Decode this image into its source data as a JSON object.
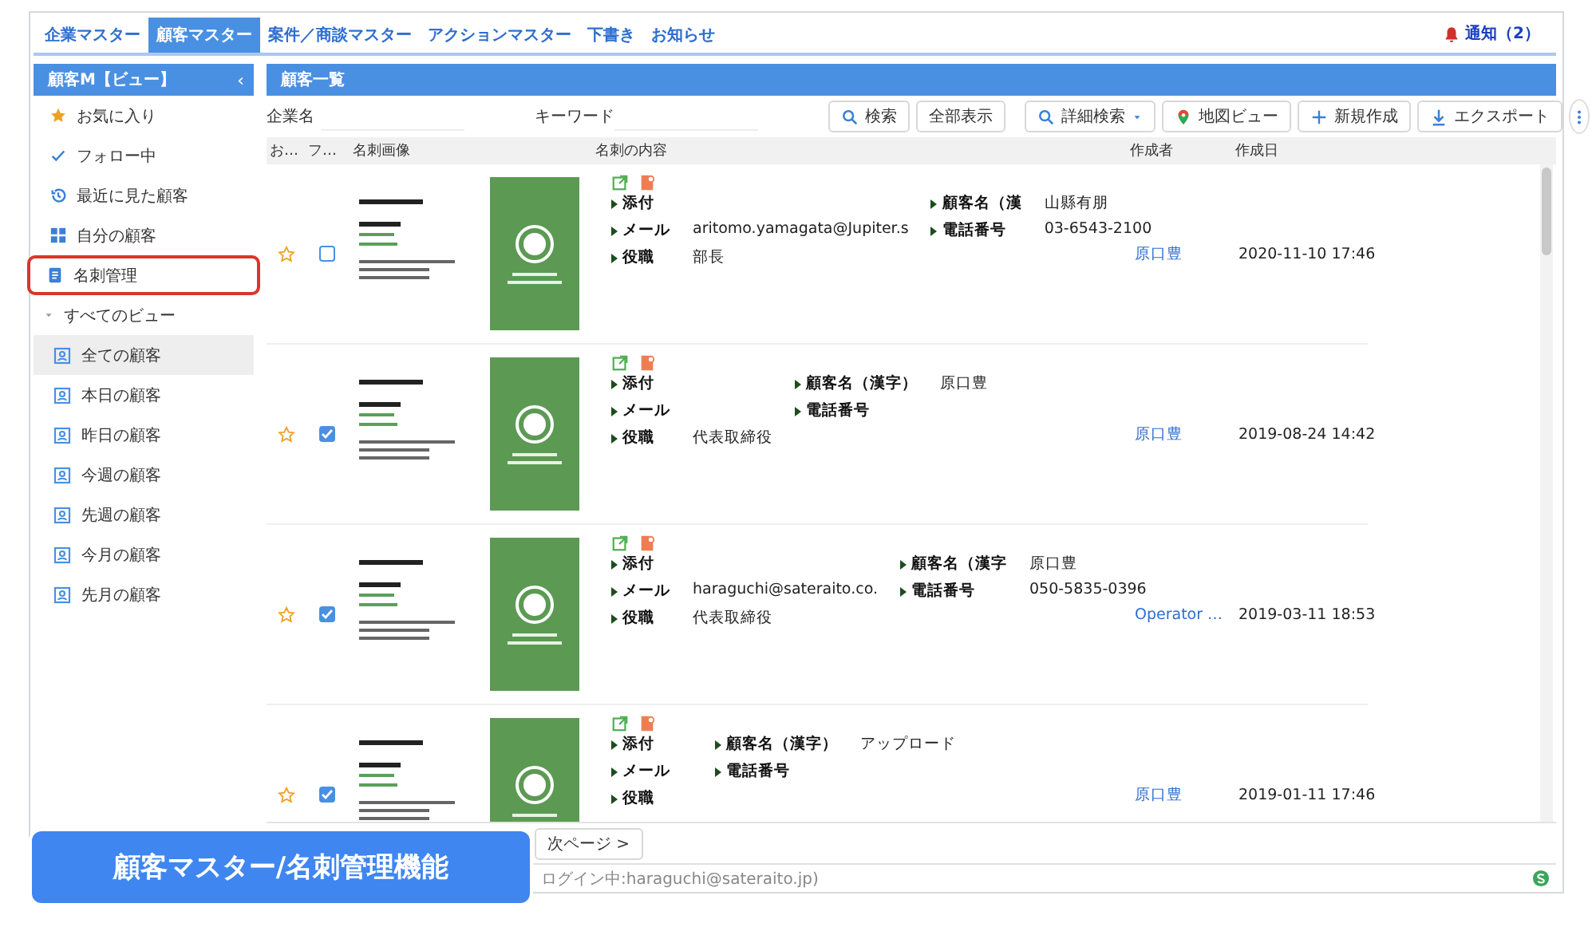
{
  "nav": {
    "tabs": [
      {
        "label": "企業マスター",
        "selected": false
      },
      {
        "label": "顧客マスター",
        "selected": true
      },
      {
        "label": "案件／商談マスター",
        "selected": false
      },
      {
        "label": "アクションマスター",
        "selected": false
      },
      {
        "label": "下書き",
        "selected": false
      },
      {
        "label": "お知らせ",
        "selected": false
      }
    ],
    "notification": "通知（2）"
  },
  "sidebar": {
    "title": "顧客M【ビュー】",
    "collapse": "‹",
    "items": [
      {
        "kind": "favorite",
        "label": "お気に入り",
        "highlighted": false
      },
      {
        "kind": "follow",
        "label": "フォロー中",
        "highlighted": false
      },
      {
        "kind": "recent",
        "label": "最近に見た顧客",
        "highlighted": false
      },
      {
        "kind": "mine",
        "label": "自分の顧客",
        "highlighted": false
      },
      {
        "kind": "cards",
        "label": "名刺管理",
        "highlighted": true
      }
    ],
    "section": {
      "label": "すべてのビュー",
      "expanded": true,
      "children": [
        {
          "label": "全ての顧客",
          "selected": true
        },
        {
          "label": "本日の顧客",
          "selected": false
        },
        {
          "label": "昨日の顧客",
          "selected": false
        },
        {
          "label": "今週の顧客",
          "selected": false
        },
        {
          "label": "先週の顧客",
          "selected": false
        },
        {
          "label": "今月の顧客",
          "selected": false
        },
        {
          "label": "先月の顧客",
          "selected": false
        }
      ]
    }
  },
  "panel": {
    "title": "顧客一覧",
    "filters": [
      {
        "label": "企業名"
      },
      {
        "label": "キーワード"
      }
    ],
    "buttons": [
      {
        "kind": "search",
        "label": "検索"
      },
      {
        "kind": "plain",
        "label": "全部表示"
      },
      {
        "kind": "advanced",
        "label": "詳細検索"
      },
      {
        "kind": "map",
        "label": "地図ビュー"
      },
      {
        "kind": "new",
        "label": "新規作成"
      },
      {
        "kind": "export",
        "label": "エクスポート"
      }
    ],
    "columns": [
      "お…",
      "フ…",
      "名刺画像",
      "名刺の内容",
      "作成者",
      "作成日"
    ],
    "rows": [
      {
        "checked": false,
        "left": [
          {
            "label": "添付"
          },
          {
            "label": "メール",
            "value": "aritomo.yamagata@Jupiter.s"
          },
          {
            "label": "役職",
            "value": "部長"
          }
        ],
        "right": [
          {
            "label": "顧客名（漢",
            "value": "山縣有朋"
          },
          {
            "label": "電話番号",
            "value": "03-6543-2100"
          }
        ],
        "creator": "原口豊",
        "date": "2020-11-10 17:46"
      },
      {
        "checked": true,
        "left": [
          {
            "label": "添付"
          },
          {
            "label": "メール"
          },
          {
            "label": "役職",
            "value": "代表取締役"
          }
        ],
        "right": [
          {
            "label": "顧客名（漢字）",
            "value": "原口豊"
          },
          {
            "label": "電話番号"
          }
        ],
        "creator": "原口豊",
        "date": "2019-08-24 14:42"
      },
      {
        "checked": true,
        "left": [
          {
            "label": "添付"
          },
          {
            "label": "メール",
            "value": "haraguchi@sateraito.co."
          },
          {
            "label": "役職",
            "value": "代表取締役"
          }
        ],
        "right": [
          {
            "label": "顧客名（漢字",
            "value": "原口豊"
          },
          {
            "label": "電話番号",
            "value": "050-5835-0396"
          }
        ],
        "creator": "Operator …",
        "date": "2019-03-11 18:53"
      },
      {
        "checked": true,
        "left": [
          {
            "label": "添付"
          },
          {
            "label": "メール"
          },
          {
            "label": "役職"
          }
        ],
        "right": [
          {
            "label": "顧客名（漢字）",
            "value": "アップロード"
          },
          {
            "label": "電話番号"
          }
        ],
        "creator": "原口豊",
        "date": "2019-01-11 17:46"
      }
    ],
    "next_page": "次ページ >",
    "status": "ログイン中:haraguchi@sateraito.jp)"
  },
  "banner": "顧客マスター/名刺管理機能"
}
